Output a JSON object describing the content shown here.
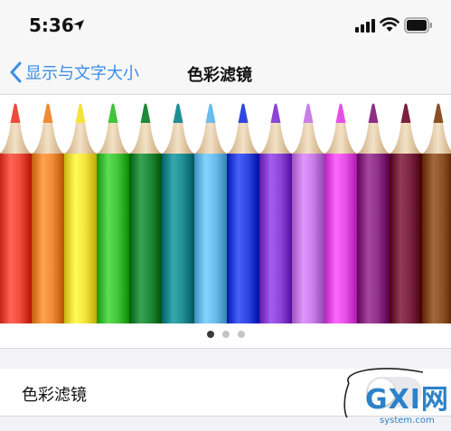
{
  "status_bar": {
    "time": "5:36",
    "icons": [
      "location-arrow-icon",
      "signal-bars-icon",
      "wifi-icon",
      "battery-icon"
    ]
  },
  "nav": {
    "back_label": "显示与文字大小",
    "title": "色彩滤镜",
    "accent_color": "#3a8ee6"
  },
  "preview": {
    "type": "pencil-color-swatches",
    "pencil_colors": [
      "#ef4b3c",
      "#f08a35",
      "#f5e33d",
      "#43c43a",
      "#1f8a3a",
      "#1f8f96",
      "#6bbcec",
      "#2f46e0",
      "#8c45d6",
      "#c97ee8",
      "#e64fe6",
      "#8e2f86",
      "#7a2240",
      "#8a5024"
    ],
    "pages": 3,
    "current_page": 1
  },
  "setting": {
    "label": "色彩滤镜",
    "toggle_on": false
  },
  "watermark": {
    "brand": "GXI网",
    "domain": "system.com"
  }
}
